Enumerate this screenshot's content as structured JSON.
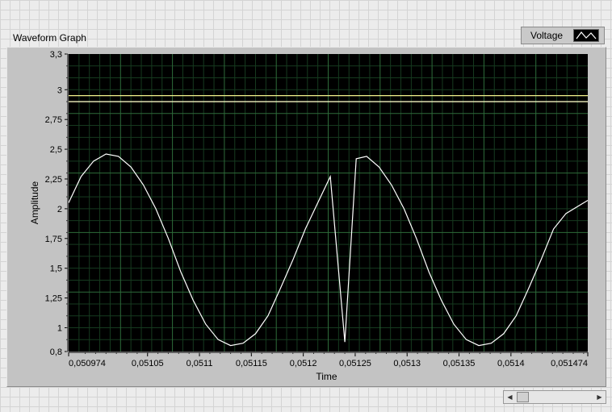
{
  "graph": {
    "title": "Waveform Graph",
    "legend_label": "Voltage",
    "legend_icon": "waveform-line-icon"
  },
  "colors": {
    "plot_bg": "#000000",
    "grid_major": "#2e6b3a",
    "grid_minor": "#163a1f",
    "trace": "#ffffff",
    "cursor_line_1": "#f4f28c",
    "cursor_line_2": "#f4f2c0"
  },
  "chart_data": {
    "type": "line",
    "title": "Waveform Graph",
    "xlabel": "Time",
    "ylabel": "Amplitude",
    "xlim": [
      0.050974,
      0.051474
    ],
    "ylim": [
      0.8,
      3.3
    ],
    "grid": true,
    "legend_placement": "top-right",
    "x_ticks": [
      {
        "value": 0.050974,
        "label": "0,050974"
      },
      {
        "value": 0.05105,
        "label": "0,05105"
      },
      {
        "value": 0.0511,
        "label": "0,0511"
      },
      {
        "value": 0.05115,
        "label": "0,05115"
      },
      {
        "value": 0.0512,
        "label": "0,0512"
      },
      {
        "value": 0.05125,
        "label": "0,05125"
      },
      {
        "value": 0.0513,
        "label": "0,0513"
      },
      {
        "value": 0.05135,
        "label": "0,05135"
      },
      {
        "value": 0.0514,
        "label": "0,0514"
      },
      {
        "value": 0.051474,
        "label": "0,051474"
      }
    ],
    "y_ticks": [
      {
        "value": 0.8,
        "label": "0,8"
      },
      {
        "value": 1,
        "label": "1"
      },
      {
        "value": 1.25,
        "label": "1,25"
      },
      {
        "value": 1.5,
        "label": "1,5"
      },
      {
        "value": 1.75,
        "label": "1,75"
      },
      {
        "value": 2,
        "label": "2"
      },
      {
        "value": 2.25,
        "label": "2,25"
      },
      {
        "value": 2.5,
        "label": "2,5"
      },
      {
        "value": 2.75,
        "label": "2,75"
      },
      {
        "value": 3,
        "label": "3"
      },
      {
        "value": 3.3,
        "label": "3,3"
      }
    ],
    "series": [
      {
        "name": "Voltage",
        "x": [
          0.050974,
          0.050986,
          0.050998,
          0.05101,
          0.051022,
          0.051034,
          0.051046,
          0.051058,
          0.05107,
          0.051082,
          0.051094,
          0.051106,
          0.051118,
          0.05113,
          0.051142,
          0.051154,
          0.051166,
          0.051178,
          0.05119,
          0.051202,
          0.051214,
          0.051226,
          0.05124,
          0.051251,
          0.051261,
          0.051273,
          0.051285,
          0.051297,
          0.051309,
          0.051321,
          0.051333,
          0.051345,
          0.051357,
          0.051369,
          0.051381,
          0.051393,
          0.051405,
          0.051417,
          0.051429,
          0.051441,
          0.051453,
          0.051474
        ],
        "y": [
          2.05,
          2.27,
          2.4,
          2.46,
          2.44,
          2.35,
          2.2,
          2.0,
          1.75,
          1.47,
          1.23,
          1.03,
          0.9,
          0.85,
          0.87,
          0.95,
          1.1,
          1.33,
          1.57,
          1.83,
          2.05,
          2.27,
          0.88,
          2.42,
          2.44,
          2.35,
          2.2,
          2.0,
          1.75,
          1.47,
          1.23,
          1.03,
          0.9,
          0.85,
          0.87,
          0.95,
          1.1,
          1.33,
          1.57,
          1.83,
          1.96,
          2.07
        ]
      }
    ],
    "horizontal_lines": [
      2.95,
      2.9
    ]
  }
}
